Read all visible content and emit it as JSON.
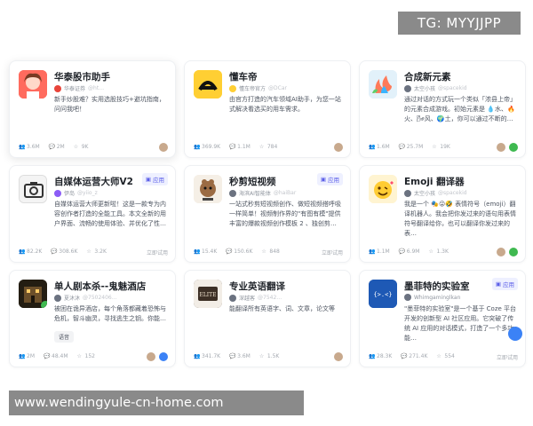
{
  "watermark_top": "TG: MYYJJPP",
  "watermark_bottom": "www.wendingyule-cn-home.com",
  "cards": [
    {
      "title": "华泰股市助手",
      "author": "华泰证券",
      "desc": "新手炒股难？实用选股技巧+避坑指南，问问我吧！",
      "stats": [
        "3.6M",
        "2M",
        "9K"
      ],
      "avatar_color": "#e8443a"
    },
    {
      "title": "懂车帝",
      "author": "懂车帝官方",
      "desc": "由官方打造的汽车领域AI助手，为您一站式解决看选买的用车需求。",
      "stats": [
        "369.9K",
        "1.1M",
        "784"
      ],
      "avatar_color": "#ffcf33"
    },
    {
      "title": "合成新元素",
      "author": "太空小孩",
      "desc": "通过对话的方式玩一个类似「浓县上帝」的元素合成游戏。初始元素是 💧水、🔥火、🌬风、🌍土，你可以通过不断的…",
      "stats": [
        "1.6M",
        "25.7M",
        "19K"
      ],
      "avatar_color": "#5db0e6"
    },
    {
      "title": "自媒体运营大师V2",
      "author": "伊岛",
      "tag": "应用",
      "desc": "自媒体运营大师更新啦！这是一款专为内容创作者打造的全能工具。本文全新的用户界面、流畅的使用体验、并优化了性…",
      "stats": [
        "82.2K",
        "308.6K",
        "3.2K"
      ],
      "foot": "立即试用",
      "avatar_color": "#2f3236"
    },
    {
      "title": "秒剪短视频",
      "author": "海滨AI智能体",
      "tag": "应用",
      "desc": "一站式秒剪短视频创作、做短视频搭呼吸一样简单！视频制作界的\"有图有模\"提供丰富的爆款视频创作模板 2 、独创剪…",
      "stats": [
        "15.4K",
        "150.6K",
        "848"
      ],
      "foot": "立即试用",
      "avatar_color": "#a0774e"
    },
    {
      "title": "Emoji 翻译器",
      "author": "太空小孩",
      "desc": "我是一个 🎭😜🤣 表情符号（emoji）翻译机器人。我会把你发过来的语句用表情符号翻译给你，也可以翻译你发过来的表…",
      "stats": [
        "1.1M",
        "6.9M",
        "1.3K"
      ],
      "avatar_color": "#ffcf4a"
    },
    {
      "title": "单人剧本杀--鬼魅酒店",
      "author": "夏沐沐",
      "desc": "被困在诡异酒店，每个角落都藏着恐怖与危机，智斗幽灵，寻找逃生之钥。你能…",
      "chip": "语音",
      "stats": [
        "2M",
        "48.4M",
        "152"
      ],
      "avatar_color": "#2a2418"
    },
    {
      "title": "专业英语翻译",
      "author": "深越客",
      "desc": "能翻译所有英语字、词、文章，论文等",
      "stats": [
        "341.7K",
        "3.6M",
        "1.5K"
      ],
      "avatar_color": "#4a3a2e"
    },
    {
      "title": "墨菲特的实验室",
      "author": "Whimgaminglkan",
      "tag": "应用",
      "desc": "\"墨菲特的实验室\"是一个基于 Coze 平台开发的创新型 AI 社区应用。它突破了传统 AI 应用的对话模式，打造了一个多功能…",
      "stats": [
        "28.3K",
        "271.4K",
        "554"
      ],
      "foot": "立即试用",
      "avatar_color": "#1e59b5"
    }
  ],
  "avatar_glyphs": [
    "",
    "",
    "",
    "",
    "",
    "",
    "",
    "ELITE",
    "{>.<}"
  ]
}
